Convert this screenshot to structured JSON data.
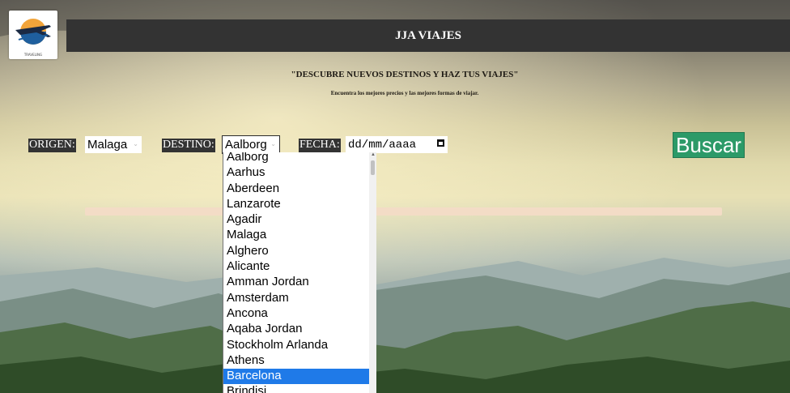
{
  "header": {
    "logo_text": "TRAVELING",
    "title": "JJA VIAJES"
  },
  "hero": {
    "headline": "\"DESCUBRE NUEVOS DESTINOS Y HAZ TUS VIAJES\"",
    "subline": "Encuentra los mejores precios y las mejores formas de viajar."
  },
  "search": {
    "origin_label": "ORIGEN:",
    "origin_value": "Malaga",
    "destination_label": "DESTINO:",
    "destination_value": "Aalborg",
    "date_label": "FECHA:",
    "date_placeholder": "dd/mm/aaaa",
    "submit_label": "Buscar"
  },
  "dropdown": {
    "options": [
      "Aalborg",
      "Aarhus",
      "Aberdeen",
      "Lanzarote",
      "Agadir",
      "Malaga",
      "Alghero",
      "Alicante",
      "Amman Jordan",
      "Amsterdam",
      "Ancona",
      "Aqaba Jordan",
      "Stockholm Arlanda",
      "Athens",
      "Barcelona",
      "Brindisi"
    ],
    "highlighted": "Barcelona"
  },
  "colors": {
    "header_bg": "#333333",
    "button_bg": "#2c9a68",
    "highlight": "#1f7ae8",
    "peach_bar": "#f3dcc6"
  }
}
